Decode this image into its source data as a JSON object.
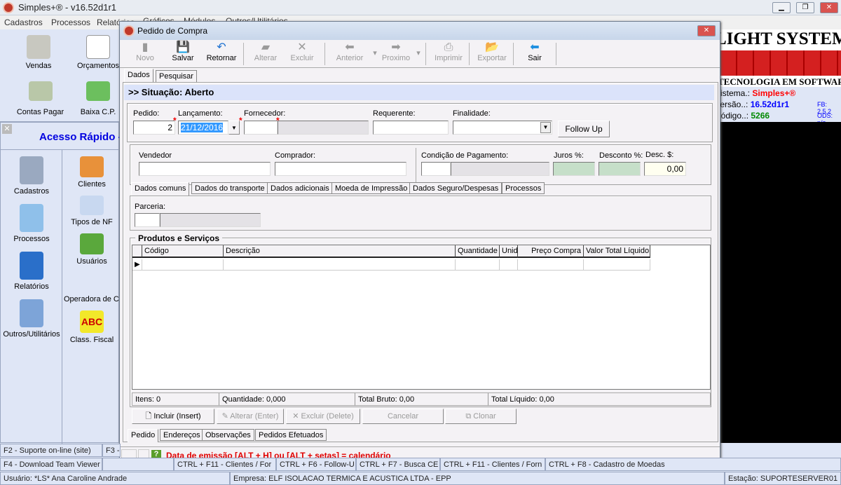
{
  "app": {
    "title": "Simples+® - v16.52d1r1"
  },
  "menu": [
    "Cadastros",
    "Processos",
    "Relatórios",
    "Gráficos",
    "Módulos",
    "Outros/Utilitários"
  ],
  "shortcuts_top": [
    {
      "label": "Vendas",
      "icon": "cash-register-icon"
    },
    {
      "label": "Orçamentos",
      "icon": "notepad-icon"
    },
    {
      "label": "Contas Pagar",
      "icon": "money-icon"
    },
    {
      "label": "Baixa C.P.",
      "icon": "card-icon"
    }
  ],
  "quick_access": {
    "title": "Acesso Rápido - ",
    "left": [
      {
        "label": "Cadastros",
        "icon": "clipboard-user-icon"
      },
      {
        "label": "Processos",
        "icon": "documents-pen-icon"
      },
      {
        "label": "Relatórios",
        "icon": "file-cabinet-icon"
      },
      {
        "label": "Outros/Utilitários",
        "icon": "laptop-icon"
      }
    ],
    "right": [
      {
        "label": "Clientes",
        "icon": "clients-icon"
      },
      {
        "label": "Tipos de NF",
        "icon": "forms-icon"
      },
      {
        "label": "Usuários",
        "icon": "users-icon"
      },
      {
        "label": "Operadora de Cartão",
        "icon": ""
      },
      {
        "label": "Class. Fiscal",
        "icon": "abc-icon"
      }
    ]
  },
  "brand": {
    "name": "LIGHT SYSTEM",
    "tagline": "TECNOLOGIA EM SOFTWARE",
    "sistema_label": "Sistema.:",
    "sistema": "Simples+®",
    "versao_label": "Versão..:",
    "versao": "16.52d1r1",
    "codigo_label": "Código..:",
    "codigo": "5266",
    "fb": "FB: 2.5.2",
    "ods": "ODS: n/a",
    "colors": {
      "sistema": "#ff0000",
      "versao": "#0000ff",
      "codigo": "#008000"
    }
  },
  "dialog": {
    "title": "Pedido de Compra",
    "toolbar": [
      {
        "label": "Novo",
        "icon": "new-doc-icon",
        "enabled": false
      },
      {
        "label": "Salvar",
        "icon": "floppy-icon",
        "enabled": true
      },
      {
        "label": "Retornar",
        "icon": "undo-icon",
        "enabled": true
      },
      {
        "label": "Alterar",
        "icon": "edit-icon",
        "enabled": false
      },
      {
        "label": "Excluir",
        "icon": "delete-icon",
        "enabled": false
      },
      {
        "label": "Anterior",
        "icon": "arrow-left-icon",
        "enabled": false
      },
      {
        "label": "Proximo",
        "icon": "arrow-right-icon",
        "enabled": false
      },
      {
        "label": "Imprimir",
        "icon": "printer-icon",
        "enabled": false
      },
      {
        "label": "Exportar",
        "icon": "export-icon",
        "enabled": false
      },
      {
        "label": "Sair",
        "icon": "exit-arrow-icon",
        "enabled": true
      }
    ],
    "tabs": [
      "Dados",
      "Pesquisar"
    ],
    "situacao": ">> Situação: Aberto",
    "fields": {
      "pedido_label": "Pedido:",
      "pedido": "2",
      "lancamento_label": "Lançamento:",
      "lancamento": "21/12/2016",
      "fornecedor_label": "Fornecedor:",
      "requerente_label": "Requerente:",
      "finalidade_label": "Finalidade:",
      "follow_up": "Follow Up",
      "vendedor_label": "Vendedor",
      "comprador_label": "Comprador:",
      "condicao_label": "Condição de Pagamento:",
      "juros_label": "Juros %:",
      "desconto_label": "Desconto %:",
      "desc_label": "Desc. $:",
      "desc": "0,00",
      "parceria_label": "Parceria:"
    },
    "subtabs": [
      "Dados comuns",
      "Dados do transporte",
      "Dados adicionais",
      "Moeda de Impressão",
      "Dados Seguro/Despesas",
      "Processos"
    ],
    "products": {
      "title": "Produtos e Serviços",
      "columns": [
        "Código",
        "Descrição",
        "Quantidade",
        "Unid",
        "Preço Compra",
        "Valor Total Líquido"
      ]
    },
    "totals": [
      "Itens: 0",
      "Quantidade: 0,000",
      "Total Bruto: 0,00",
      "Total Líquido: 0,00"
    ],
    "actions": [
      {
        "label": "Incluir (Insert)",
        "enabled": true
      },
      {
        "label": "Alterar (Enter)",
        "enabled": false
      },
      {
        "label": "Excluir (Delete)",
        "enabled": false
      },
      {
        "label": "Cancelar",
        "enabled": false
      },
      {
        "label": "Clonar",
        "enabled": false
      }
    ],
    "bottom_tabs": [
      "Pedido",
      "Endereços",
      "Observações",
      "Pedidos Efetuados"
    ],
    "hint": "Data de emissão [ALT + H] ou [ALT + setas] = calendário"
  },
  "fkeys_row1": [
    "F2 - Suporte on-line (site)",
    "F3 -"
  ],
  "fkeys_row2": [
    "F4 - Download Team Viewer",
    "",
    "CTRL + F11 - Clientes / For",
    "CTRL + F6 - Follow-U",
    "CTRL + F7 - Busca CE",
    "CTRL + F11 - Clientes / Forn",
    "CTRL + F8 - Cadastro de Moedas"
  ],
  "status": {
    "usuario": "Usuário: *LS* Ana Caroline Andrade",
    "empresa": "Empresa: ELF ISOLACAO TERMICA E ACUSTICA LTDA - EPP",
    "estacao": "Estação: SUPORTESERVER01"
  }
}
